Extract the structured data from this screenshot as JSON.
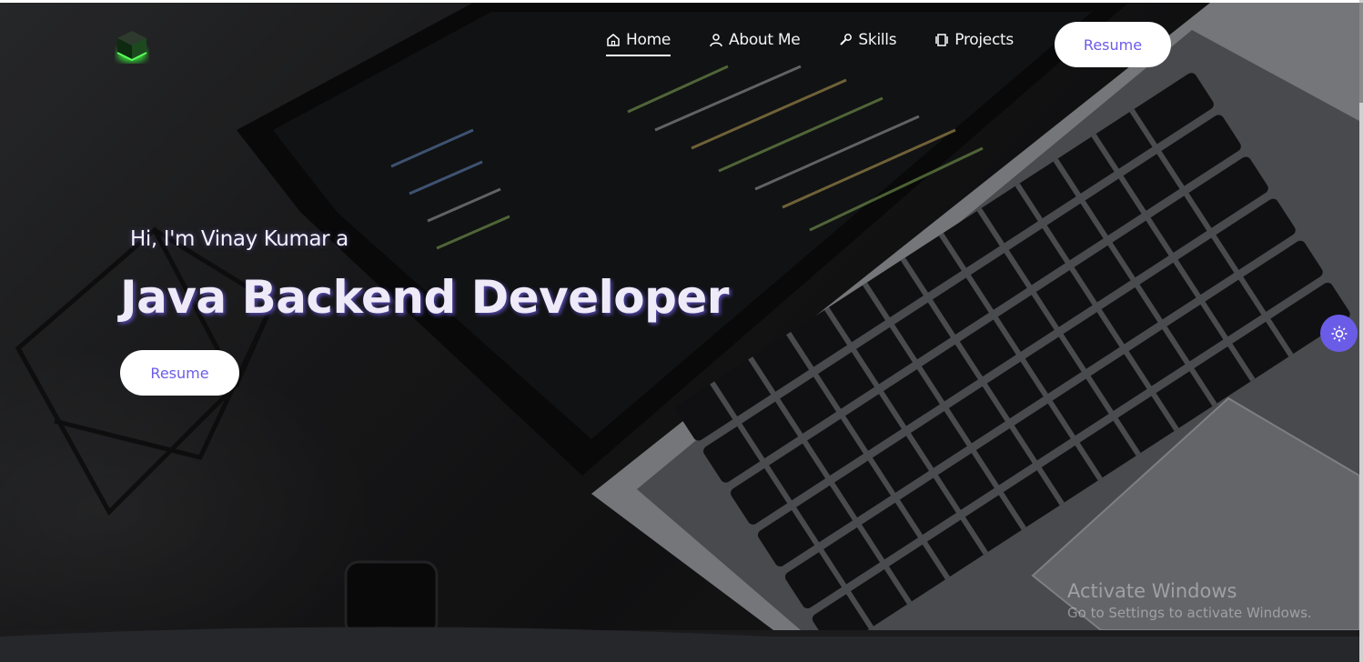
{
  "nav": {
    "items": [
      {
        "label": "Home",
        "icon": "home-icon"
      },
      {
        "label": "About Me",
        "icon": "user-icon"
      },
      {
        "label": "Skills",
        "icon": "tools-icon"
      },
      {
        "label": "Projects",
        "icon": "projects-icon"
      }
    ],
    "resume_label": "Resume"
  },
  "hero": {
    "greeting": "Hi, I'm Vinay Kumar a",
    "title": "Java Backend Developer",
    "resume_label": "Resume"
  },
  "watermark": {
    "title": "Activate Windows",
    "subtitle": "Go to Settings to activate Windows."
  },
  "colors": {
    "accent": "#6b5ce7",
    "logo_glow": "#39ff3a",
    "button_bg": "#ffffff",
    "footer_band": "#26272b"
  }
}
